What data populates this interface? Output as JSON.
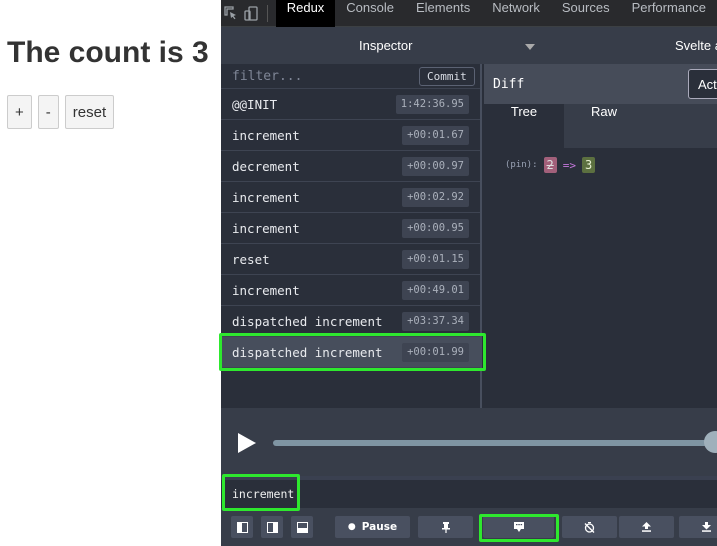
{
  "app": {
    "heading": "The count is 3",
    "buttons": {
      "plus": "+",
      "minus": "-",
      "reset": "reset"
    }
  },
  "devtools": {
    "tabs": [
      "Redux",
      "Console",
      "Elements",
      "Network",
      "Sources",
      "Performance"
    ],
    "active_tab": "Redux",
    "subbar": {
      "inspector": "Inspector",
      "svelte": "Svelte a"
    },
    "filter": {
      "placeholder": "filter...",
      "commit_label": "Commit"
    },
    "actions": [
      {
        "name": "@@INIT",
        "time": "1:42:36.95"
      },
      {
        "name": "increment",
        "time": "+00:01.67"
      },
      {
        "name": "decrement",
        "time": "+00:00.97"
      },
      {
        "name": "increment",
        "time": "+00:02.92"
      },
      {
        "name": "increment",
        "time": "+00:00.95"
      },
      {
        "name": "reset",
        "time": "+00:01.15"
      },
      {
        "name": "increment",
        "time": "+00:49.01"
      },
      {
        "name": "dispatched increment",
        "time": "+03:37.34"
      },
      {
        "name": "dispatched increment",
        "time": "+00:01.99"
      }
    ],
    "selected_action_index": 8,
    "diff": {
      "title": "Diff",
      "action_button": "Act",
      "tabs": {
        "tree": "Tree",
        "raw": "Raw"
      },
      "active_tab": "Tree",
      "line": {
        "key": "(pin):",
        "old": "2",
        "arrow": "=>",
        "new": "3"
      }
    },
    "slider": {
      "progress": 1.0
    },
    "dispatcher": {
      "value": "increment"
    },
    "toolbar": {
      "pause_label": "Pause"
    },
    "colors": {
      "highlight": "#2ee82e",
      "active_tab_bg": "#000000",
      "panel_bg": "#2a2f3a"
    }
  }
}
